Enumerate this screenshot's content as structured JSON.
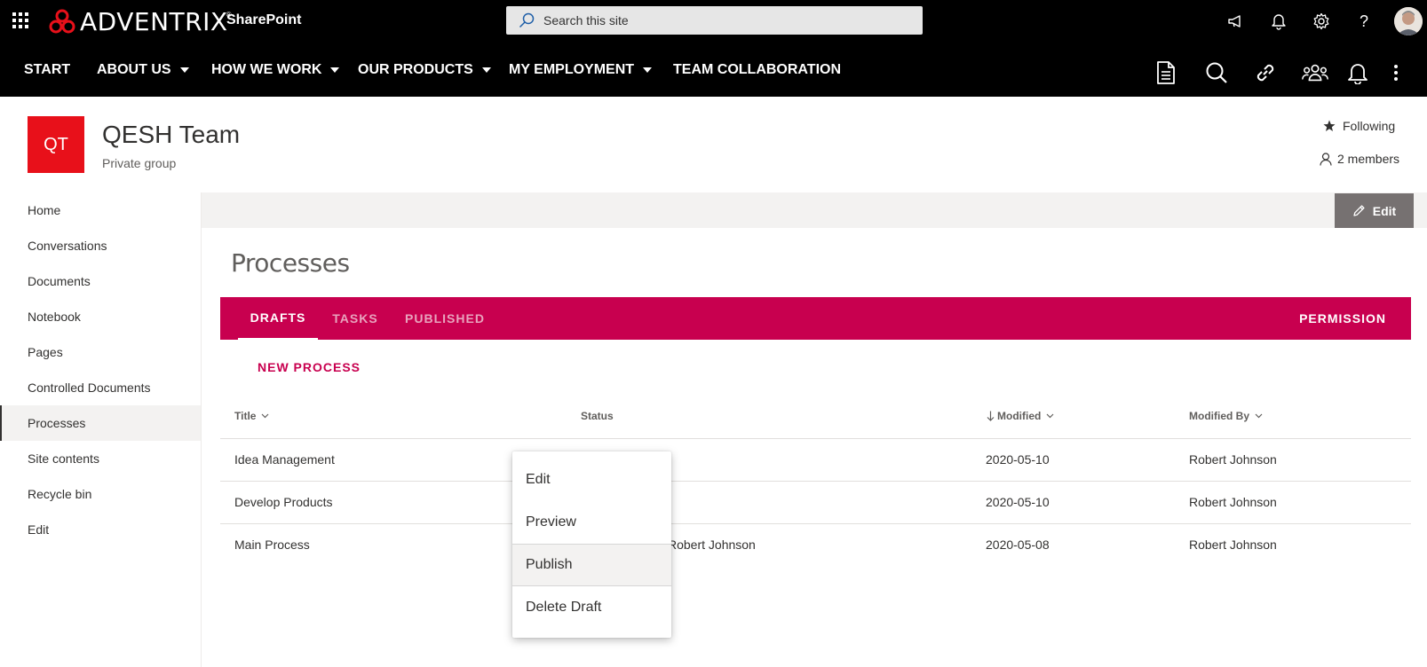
{
  "suite": {
    "brand_name": "ADVENTRIX",
    "brand_reg": "®",
    "app_name": "SharePoint",
    "search_placeholder": "Search this site",
    "icons": [
      "waffle-icon",
      "megaphone-icon",
      "bell-icon",
      "gear-icon",
      "help-icon",
      "avatar"
    ]
  },
  "hubnav": {
    "items": [
      {
        "label": "START",
        "dropdown": false
      },
      {
        "label": "ABOUT US",
        "dropdown": true
      },
      {
        "label": "HOW WE WORK",
        "dropdown": true
      },
      {
        "label": "OUR PRODUCTS",
        "dropdown": true
      },
      {
        "label": "MY EMPLOYMENT",
        "dropdown": true
      },
      {
        "label": "TEAM COLLABORATION",
        "dropdown": false
      }
    ],
    "right_icons": [
      "document-icon",
      "search-icon",
      "link-icon",
      "people-icon",
      "bell-icon",
      "more-icon"
    ]
  },
  "site": {
    "logo_text": "QT",
    "logo_color": "#e8101a",
    "title": "QESH Team",
    "subtitle": "Private group",
    "following": "Following",
    "members": "2 members"
  },
  "leftnav": {
    "items": [
      "Home",
      "Conversations",
      "Documents",
      "Notebook",
      "Pages",
      "Controlled Documents",
      "Processes",
      "Site contents",
      "Recycle bin",
      "Edit"
    ],
    "selected": "Processes"
  },
  "commandbar": {
    "edit_label": "Edit"
  },
  "main": {
    "heading": "Processes",
    "accent_color": "#c8004f",
    "tabs": [
      {
        "label": "DRAFTS",
        "active": true
      },
      {
        "label": "TASKS",
        "active": false
      },
      {
        "label": "PUBLISHED",
        "active": false
      }
    ],
    "permission_label": "PERMISSION",
    "new_process_label": "NEW PROCESS",
    "columns": {
      "title": "Title",
      "status": "Status",
      "modified": "Modified",
      "modified_by": "Modified By"
    },
    "rows": [
      {
        "title": "Idea Management",
        "status": "",
        "modified": "2020-05-10",
        "modified_by": "Robert Johnson"
      },
      {
        "title": "Develop Products",
        "status": "",
        "modified": "2020-05-10",
        "modified_by": "Robert Johnson"
      },
      {
        "title": "Main Process",
        "status": "Robert Johnson",
        "modified": "2020-05-08",
        "modified_by": "Robert Johnson"
      }
    ]
  },
  "context_menu": {
    "items": [
      "Edit",
      "Preview",
      "Publish",
      "Delete Draft"
    ],
    "hovered": "Publish"
  }
}
